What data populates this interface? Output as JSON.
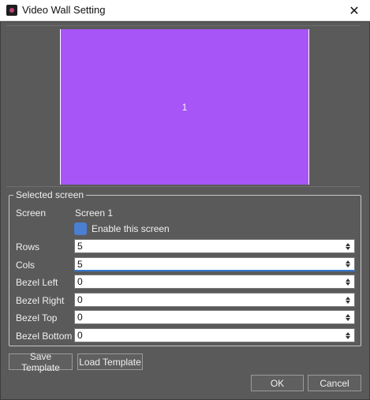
{
  "window": {
    "title": "Video Wall Setting",
    "close_icon": "close-icon"
  },
  "preview": {
    "tile_label": "1",
    "tile_color": "#a855f7"
  },
  "selected_screen": {
    "group_title": "Selected screen",
    "screen_label": "Screen",
    "screen_value": "Screen 1",
    "enable_label": "Enable this screen",
    "enable_checked": true,
    "fields": {
      "rows": {
        "label": "Rows",
        "value": "5"
      },
      "cols": {
        "label": "Cols",
        "value": "5"
      },
      "bezel_left": {
        "label": "Bezel Left",
        "value": "0"
      },
      "bezel_right": {
        "label": "Bezel Right",
        "value": "0"
      },
      "bezel_top": {
        "label": "Bezel Top",
        "value": "0"
      },
      "bezel_bottom": {
        "label": "Bezel Bottom",
        "value": "0"
      }
    }
  },
  "buttons": {
    "save_template": "Save Template",
    "load_template": "Load Template",
    "ok": "OK",
    "cancel": "Cancel"
  }
}
